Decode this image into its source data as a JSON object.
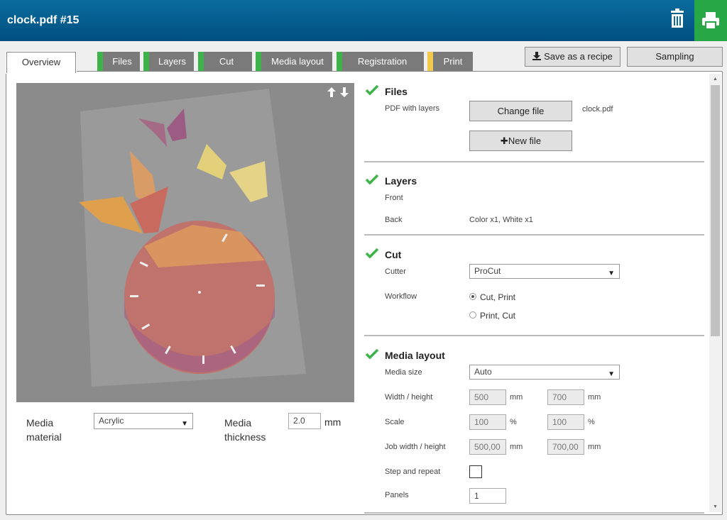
{
  "window": {
    "title": "clock.pdf #15"
  },
  "tabs": [
    {
      "label": "Overview",
      "status_color": null
    },
    {
      "label": "Files",
      "status_color": "#3db34a"
    },
    {
      "label": "Layers",
      "status_color": "#3db34a"
    },
    {
      "label": "Cut",
      "status_color": "#3db34a"
    },
    {
      "label": "Media layout",
      "status_color": "#3db34a"
    },
    {
      "label": "Registration",
      "status_color": "#3db34a"
    },
    {
      "label": "Print",
      "status_color": "#f2c94c"
    }
  ],
  "actions": {
    "save_recipe": "Save as a recipe",
    "sampling": "Sampling"
  },
  "preview": {
    "arrows": "🡑🡓"
  },
  "media": {
    "material_label": "Media material",
    "material_value": "Acrylic",
    "thickness_label": "Media thickness",
    "thickness_value": "2.0",
    "thickness_unit": "mm"
  },
  "files": {
    "title": "Files",
    "pdf_label": "PDF with layers",
    "change_file": "Change file",
    "file_name": "clock.pdf",
    "new_file": "New file"
  },
  "layers": {
    "title": "Layers",
    "front_label": "Front",
    "back_label": "Back",
    "back_value": "Color x1, White x1"
  },
  "cut": {
    "title": "Cut",
    "cutter_label": "Cutter",
    "cutter_value": "ProCut",
    "workflow_label": "Workflow",
    "options": [
      "Cut, Print",
      "Print, Cut"
    ],
    "selected": "Cut, Print"
  },
  "media_layout": {
    "title": "Media layout",
    "size_label": "Media size",
    "size_value": "Auto",
    "wh_label": "Width / height",
    "width": "500",
    "height": "700",
    "mm": "mm",
    "scale_label": "Scale",
    "scale_x": "100",
    "scale_y": "100",
    "pct": "%",
    "job_label": "Job width / height",
    "job_width": "500,00",
    "job_height": "700,00",
    "step_label": "Step and repeat",
    "step_checked": false,
    "panels_label": "Panels",
    "panels_value": "1"
  },
  "colors": {
    "header": "#00507f",
    "ok": "#3db34a",
    "warn": "#f2c94c"
  }
}
